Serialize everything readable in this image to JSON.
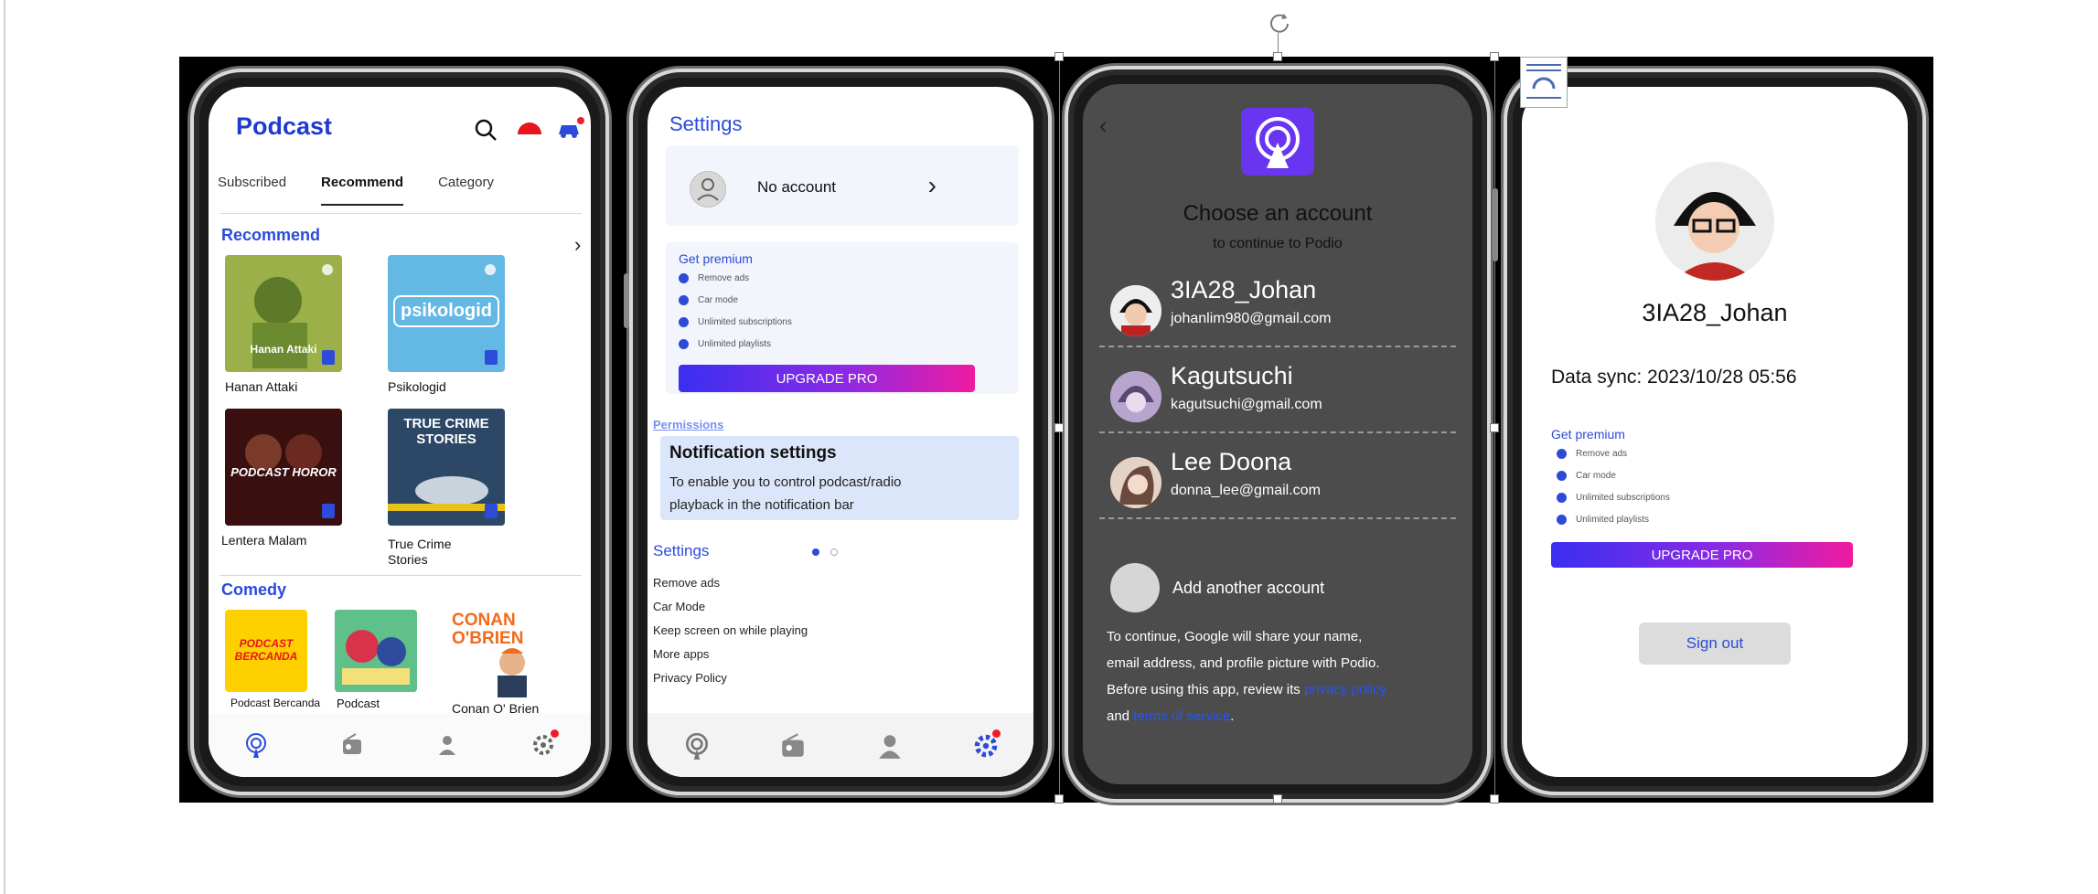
{
  "phone1": {
    "title": "Podcast",
    "tabs": [
      "Subscribed",
      "Recommend",
      "Category"
    ],
    "active_tab": "Recommend",
    "recommend_section": "Recommend",
    "tiles": [
      {
        "label": "Hanan Attaki",
        "art_text": "Hanan Attaki",
        "color": "#8fa83a"
      },
      {
        "label": "Psikologid",
        "art_text": "psikologid",
        "color": "#63b9e4"
      },
      {
        "label": "Lentera Malam",
        "art_text": "PODCAST HOROR",
        "color": "#5a1a1a"
      },
      {
        "label": "True Crime Stories",
        "art_text": "TRUE CRIME STORIES",
        "color": "#243a52"
      }
    ],
    "comedy_section": "Comedy",
    "comedy_tiles": [
      {
        "label": "Podcast Bercanda",
        "art_text": "PODCAST BERCANDA",
        "color": "#ffd000"
      },
      {
        "label": "Podcast Sarcasm",
        "art_text": "",
        "color": "#3aa86e"
      },
      {
        "label": "Conan O' Brien",
        "art_text": "CONAN O'BRIEN",
        "color": "#ffffff"
      }
    ]
  },
  "phone2": {
    "header": "Settings",
    "account_label": "No account",
    "premium": {
      "title": "Get premium",
      "items": [
        "Remove ads",
        "Car mode",
        "Unlimited subscriptions",
        "Unlimited playlists"
      ],
      "button": "UPGRADE PRO"
    },
    "permissions_label": "Permissions",
    "notif_title": "Notification settings",
    "notif_desc_1": "To enable you to control podcast/radio",
    "notif_desc_2": "playback in the notification bar",
    "settings_title": "Settings",
    "settings_items": [
      "Remove ads",
      "Car Mode",
      "Keep screen on while playing",
      "More apps",
      "Privacy Policy"
    ]
  },
  "phone3": {
    "title": "Choose an account",
    "subtitle": "to continue to Podio",
    "accounts": [
      {
        "name": "3IA28_Johan",
        "email": "johanlim980@gmail.com"
      },
      {
        "name": "Kagutsuchi",
        "email": "kagutsuchi@gmail.com"
      },
      {
        "name": "Lee Doona",
        "email": "donna_lee@gmail.com"
      }
    ],
    "add_account": "Add another account",
    "consent_1": "To continue, Google will share your name,",
    "consent_2": "email address, and profile picture with Podio.",
    "consent_3": "Before using this app, review its",
    "privacy_link": "privacy policy",
    "consent_and": "and",
    "terms_link": "terms of service",
    "consent_end": "."
  },
  "phone4": {
    "name": "3IA28_Johan",
    "sync": "Data sync: 2023/10/28 05:56",
    "premium": {
      "title": "Get premium",
      "items": [
        "Remove ads",
        "Car mode",
        "Unlimited subscriptions",
        "Unlimited playlists"
      ],
      "button": "UPGRADE PRO"
    },
    "sign_out": "Sign out"
  },
  "colors": {
    "accent": "#2b4bd8",
    "notification_dot": "#f01c2c",
    "dark_screen": "#4c4c4c"
  }
}
